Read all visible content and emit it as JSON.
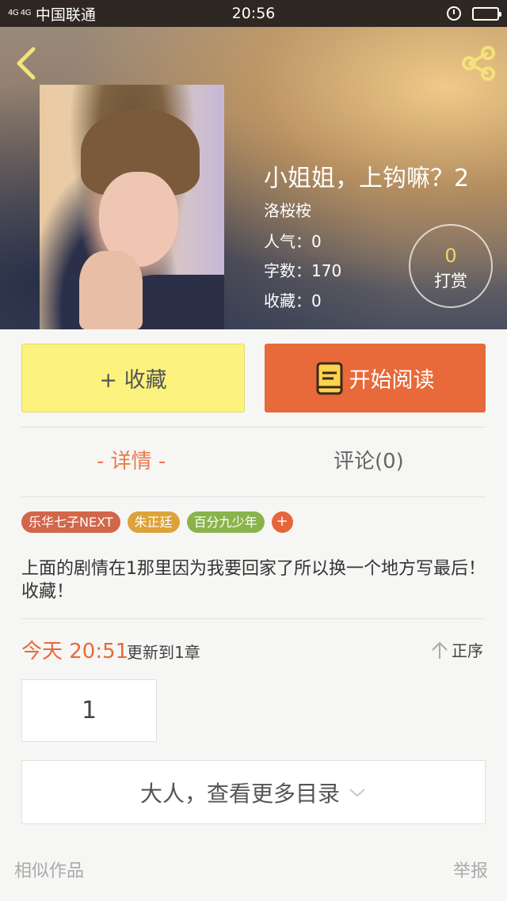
{
  "status_bar": {
    "network": "4G 4G",
    "carrier": "中国联通",
    "time": "20:56"
  },
  "book": {
    "title": "小姐姐，上钩嘛？2",
    "author": "洛桜桉",
    "popularity": "人气：0",
    "word_count": "字数：170",
    "favorites": "收藏：0"
  },
  "tip": {
    "count": "0",
    "label": "打赏"
  },
  "actions": {
    "favorite_label": "+ 收藏",
    "read_label": "开始阅读"
  },
  "tabs": {
    "detail": "- 详情 -",
    "comments": "评论(0)"
  },
  "tags": [
    {
      "label": "乐华七子NEXT",
      "color": "#d2664a"
    },
    {
      "label": "朱正廷",
      "color": "#dca33a"
    },
    {
      "label": "百分九少年",
      "color": "#8ab34c"
    }
  ],
  "tag_add": "+",
  "description": "上面的剧情在1那里因为我要回家了所以换一个地方写最后！收藏！",
  "update": {
    "time": "今天 20:51",
    "text": "更新到1章",
    "sort_label": "正序"
  },
  "chapters": [
    "1"
  ],
  "more_toc_label": "大人，查看更多目录",
  "similar_label": "相似作品",
  "report_label": "举报",
  "colors": {
    "accent": "#e8693a",
    "favorite_bg": "#fcf37e",
    "tip_count": "#f5d36b"
  }
}
